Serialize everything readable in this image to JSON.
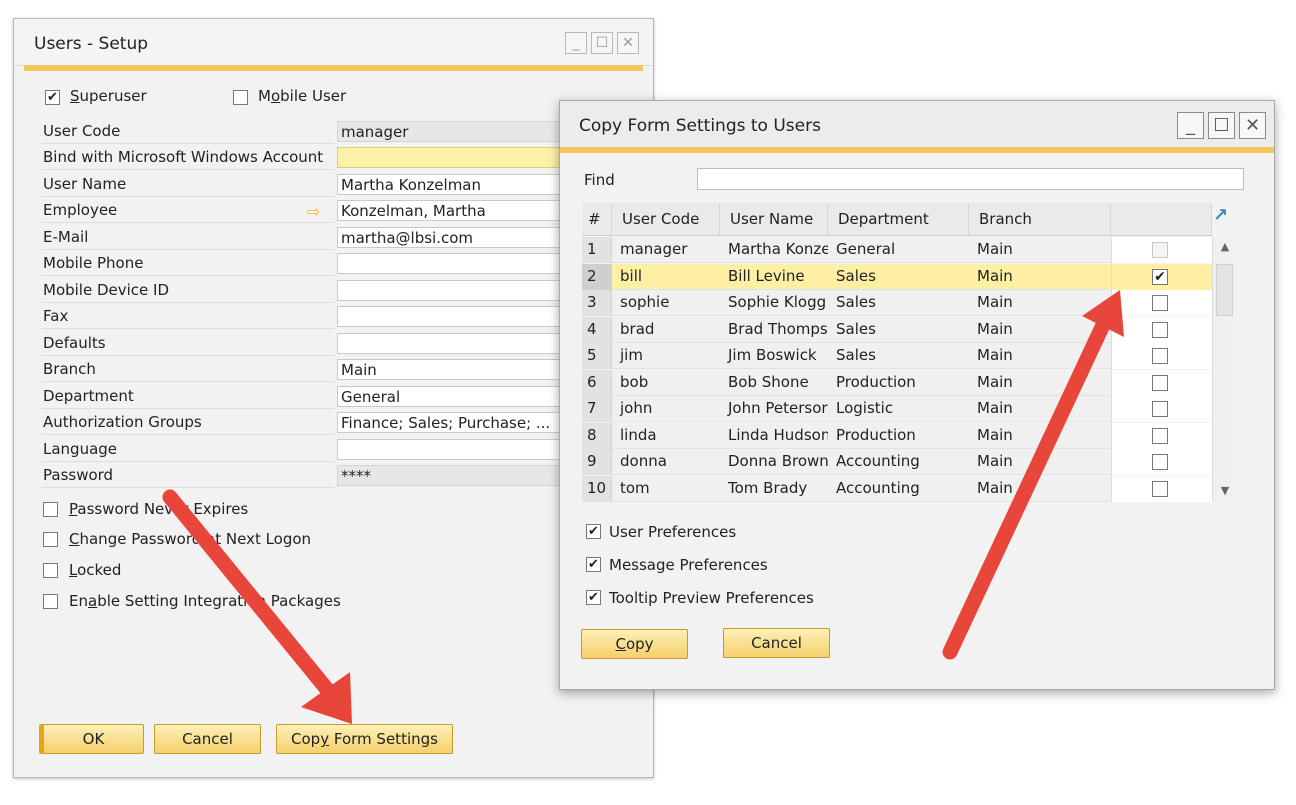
{
  "users_setup": {
    "title": "Users - Setup",
    "superuser": {
      "label_prefix": "",
      "label_u": "S",
      "label_rest": "uperuser",
      "checked": true
    },
    "mobile_user": {
      "label_prefix": "M",
      "label_u": "o",
      "label_rest": "bile User",
      "checked": false
    },
    "fields": [
      {
        "label": "User Code",
        "value": "manager",
        "style": "readonly"
      },
      {
        "label": "Bind with Microsoft Windows Account",
        "value": "",
        "style": "highlight"
      },
      {
        "label": "User Name",
        "value": "Martha Konzelman",
        "style": "normal"
      },
      {
        "label": "Employee",
        "value": "Konzelman, Martha",
        "style": "normal",
        "link_arrow": "⇨"
      },
      {
        "label": "E-Mail",
        "value": "martha@lbsi.com",
        "style": "normal"
      },
      {
        "label": "Mobile Phone",
        "value": "",
        "style": "normal"
      },
      {
        "label": "Mobile Device ID",
        "value": "",
        "style": "normal"
      },
      {
        "label": "Fax",
        "value": "",
        "style": "normal"
      },
      {
        "label": "Defaults",
        "value": "",
        "style": "normal"
      },
      {
        "label": "Branch",
        "value": "Main",
        "style": "normal"
      },
      {
        "label": "Department",
        "value": "General",
        "style": "normal"
      },
      {
        "label": "Authorization Groups",
        "value": "Finance; Sales; Purchase;  ...",
        "style": "normal"
      },
      {
        "label": "Language",
        "value": "",
        "style": "normal"
      },
      {
        "label": "Password",
        "value": "****",
        "style": "readonly"
      }
    ],
    "options": [
      {
        "prefix": "",
        "u": "P",
        "rest": "assword Never Expires",
        "checked": false
      },
      {
        "prefix": "",
        "u": "C",
        "rest": "hange Password at Next Logon",
        "checked": false
      },
      {
        "prefix": "",
        "u": "L",
        "rest": "ocked",
        "checked": false
      },
      {
        "prefix": "En",
        "u": "a",
        "rest": "ble Setting Integration Packages",
        "checked": false
      }
    ],
    "buttons": {
      "ok": "OK",
      "cancel": "Cancel",
      "copy_prefix": "Cop",
      "copy_u": "y",
      "copy_rest": " Form Settings"
    }
  },
  "copy_form": {
    "title": "Copy Form Settings to Users",
    "find_label": "Find",
    "find_value": "",
    "columns": [
      "#",
      "User Code",
      "User Name",
      "Department",
      "Branch",
      ""
    ],
    "rows": [
      {
        "n": "1",
        "code": "manager",
        "name": "Martha Konze",
        "dept": "General",
        "branch": "Main",
        "checked": false,
        "disabled": true,
        "selected": false
      },
      {
        "n": "2",
        "code": "bill",
        "name": "Bill Levine",
        "dept": "Sales",
        "branch": "Main",
        "checked": true,
        "disabled": false,
        "selected": true
      },
      {
        "n": "3",
        "code": "sophie",
        "name": "Sophie Klogg",
        "dept": "Sales",
        "branch": "Main",
        "checked": false,
        "disabled": false,
        "selected": false
      },
      {
        "n": "4",
        "code": "brad",
        "name": "Brad Thomps",
        "dept": "Sales",
        "branch": "Main",
        "checked": false,
        "disabled": false,
        "selected": false
      },
      {
        "n": "5",
        "code": "jim",
        "name": "Jim Boswick",
        "dept": "Sales",
        "branch": "Main",
        "checked": false,
        "disabled": false,
        "selected": false
      },
      {
        "n": "6",
        "code": "bob",
        "name": "Bob Shone",
        "dept": "Production",
        "branch": "Main",
        "checked": false,
        "disabled": false,
        "selected": false
      },
      {
        "n": "7",
        "code": "john",
        "name": "John Petersor",
        "dept": "Logistic",
        "branch": "Main",
        "checked": false,
        "disabled": false,
        "selected": false
      },
      {
        "n": "8",
        "code": "linda",
        "name": "Linda Hudson",
        "dept": "Production",
        "branch": "Main",
        "checked": false,
        "disabled": false,
        "selected": false
      },
      {
        "n": "9",
        "code": "donna",
        "name": "Donna Brown",
        "dept": "Accounting",
        "branch": "Main",
        "checked": false,
        "disabled": false,
        "selected": false
      },
      {
        "n": "10",
        "code": "tom",
        "name": "Tom Brady",
        "dept": "Accounting",
        "branch": "Main",
        "checked": false,
        "disabled": false,
        "selected": false
      }
    ],
    "options": [
      {
        "label": "User Preferences",
        "checked": true
      },
      {
        "label": "Message Preferences",
        "checked": true
      },
      {
        "label": "Tooltip Preview Preferences",
        "checked": true
      }
    ],
    "buttons": {
      "copy_u": "C",
      "copy_rest": "opy",
      "cancel": "Cancel"
    }
  },
  "window_controls": {
    "minimize": "_",
    "maximize": "☐",
    "close": "✕"
  },
  "colors": {
    "accent": "#f4c85a",
    "button": "#f5d06c",
    "arrow": "#e8463a",
    "selected_row": "#fdf0a4"
  }
}
